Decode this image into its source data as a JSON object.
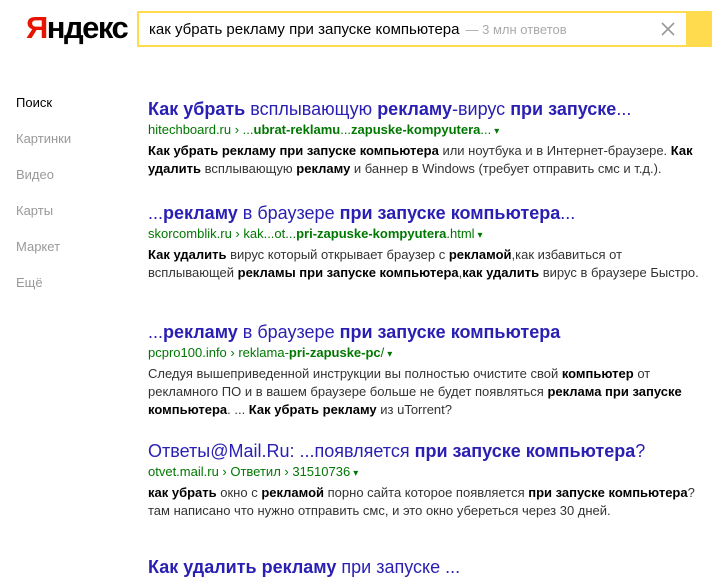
{
  "header": {
    "logo_first": "Я",
    "logo_rest": "ндекс",
    "query": "как убрать рекламу при запуске компьютера",
    "result_count": "— 3 млн ответов"
  },
  "sidebar": {
    "items": [
      {
        "label": "Поиск",
        "active": true
      },
      {
        "label": "Картинки",
        "active": false
      },
      {
        "label": "Видео",
        "active": false
      },
      {
        "label": "Карты",
        "active": false
      },
      {
        "label": "Маркет",
        "active": false
      },
      {
        "label": "Ещё",
        "active": false
      }
    ]
  },
  "results": [
    {
      "title": [
        [
          "b",
          "Как убрать"
        ],
        [
          "n",
          " всплывающую "
        ],
        [
          "b",
          "рекламу"
        ],
        [
          "n",
          "-вирус "
        ],
        [
          "b",
          "при запуске"
        ],
        [
          "n",
          "..."
        ]
      ],
      "url": [
        [
          "n",
          "hitechboard.ru › ..."
        ],
        [
          "b",
          "ubrat-reklamu"
        ],
        [
          "n",
          "..."
        ],
        [
          "b",
          "zapuske-kompyutera"
        ],
        [
          "n",
          "..."
        ]
      ],
      "snippet": [
        [
          "b",
          "Как убрать рекламу при запуске компьютера"
        ],
        [
          "n",
          " или ноутбука и в Интернет-браузере. "
        ],
        [
          "b",
          "Как удалить"
        ],
        [
          "n",
          " всплывающую "
        ],
        [
          "b",
          "рекламу"
        ],
        [
          "n",
          " и баннер в Windows (требует отправить смс и т.д.)."
        ]
      ]
    },
    {
      "title": [
        [
          "n",
          "..."
        ],
        [
          "b",
          "рекламу"
        ],
        [
          "n",
          " в браузере "
        ],
        [
          "b",
          "при запуске компьютера"
        ],
        [
          "n",
          "..."
        ]
      ],
      "url": [
        [
          "n",
          "skorcomblik.ru › kak...ot..."
        ],
        [
          "b",
          "pri-zapuske-kompyutera"
        ],
        [
          "n",
          ".html"
        ]
      ],
      "snippet": [
        [
          "b",
          "Как удалить"
        ],
        [
          "n",
          " вирус который открывает браузер с "
        ],
        [
          "b",
          "рекламой"
        ],
        [
          "n",
          ",как избавиться от всплывающей "
        ],
        [
          "b",
          "рекламы при запуске компьютера"
        ],
        [
          "n",
          ","
        ],
        [
          "b",
          "как удалить"
        ],
        [
          "n",
          " вирус в браузере Быстро."
        ]
      ]
    },
    {
      "title": [
        [
          "n",
          "..."
        ],
        [
          "b",
          "рекламу"
        ],
        [
          "n",
          " в браузере "
        ],
        [
          "b",
          "при запуске компьютера"
        ]
      ],
      "url": [
        [
          "n",
          "pcpro100.info › reklama-"
        ],
        [
          "b",
          "pri-zapuske-pc"
        ],
        [
          "n",
          "/"
        ]
      ],
      "snippet": [
        [
          "n",
          "Следуя вышеприведенной инструкции вы полностью очистите свой "
        ],
        [
          "b",
          "компьютер"
        ],
        [
          "n",
          " от рекламного ПО и в вашем браузере больше не будет появляться "
        ],
        [
          "b",
          "реклама при запуске компьютера"
        ],
        [
          "n",
          ". ... "
        ],
        [
          "b",
          "Как убрать рекламу"
        ],
        [
          "n",
          " из uTorrent?"
        ]
      ]
    },
    {
      "title": [
        [
          "n",
          "Ответы@Mail.Ru: ...появляется "
        ],
        [
          "b",
          "при запуске компьютера"
        ],
        [
          "n",
          "?"
        ]
      ],
      "url": [
        [
          "n",
          "otvet.mail.ru › Ответил › 31510736"
        ]
      ],
      "snippet": [
        [
          "b",
          "как убрать"
        ],
        [
          "n",
          " окно с "
        ],
        [
          "b",
          "рекламой"
        ],
        [
          "n",
          " порно сайта которое появляется "
        ],
        [
          "b",
          "при запуске компьютера"
        ],
        [
          "n",
          "? там написано что нужно отправить смс, и это окно убереться через 30 дней."
        ]
      ]
    },
    {
      "title": [
        [
          "b",
          "Как удалить рекламу"
        ],
        [
          "n",
          " при запуске ..."
        ]
      ],
      "url": [],
      "snippet": []
    }
  ]
}
